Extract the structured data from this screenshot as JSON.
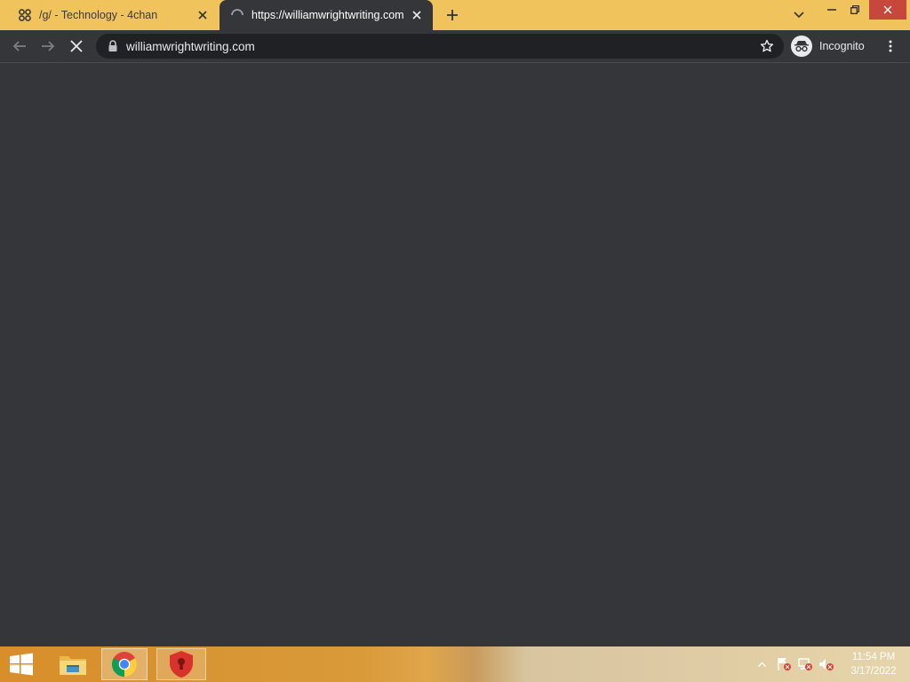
{
  "browser": {
    "tabs": [
      {
        "title": "/g/ - Technology - 4chan",
        "state": "inactive",
        "icon": "4chan-clover-icon"
      },
      {
        "title": "https://williamwrightwriting.com",
        "state": "active-loading",
        "icon": "loading-spinner-icon"
      }
    ],
    "address_bar": {
      "url": "williamwrightwriting.com"
    },
    "profile": {
      "label": "Incognito"
    }
  },
  "taskbar": {
    "apps": [
      {
        "name": "File Explorer",
        "icon": "file-explorer-icon"
      },
      {
        "name": "Google Chrome",
        "icon": "chrome-icon",
        "active": true
      },
      {
        "name": "Security app",
        "icon": "red-shield-icon"
      }
    ],
    "clock": {
      "time": "11:54 PM",
      "date": "3/17/2022"
    }
  },
  "colors": {
    "tabstrip": "#f0c35c",
    "toolbar": "#35363a",
    "omnibox": "#202124",
    "window_close": "#c8473d"
  }
}
